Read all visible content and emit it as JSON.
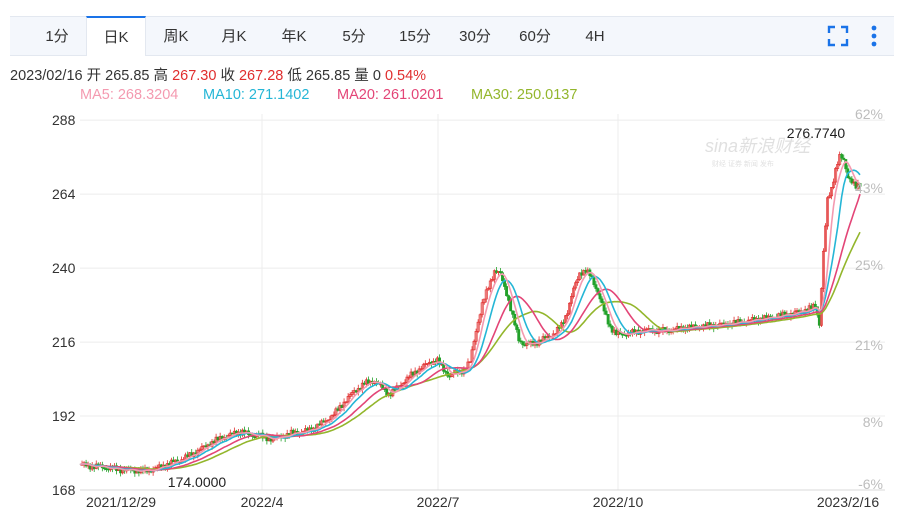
{
  "tabs": [
    {
      "label": "1分"
    },
    {
      "label": "日K",
      "active": true
    },
    {
      "label": "周K"
    },
    {
      "label": "月K"
    },
    {
      "label": "年K"
    },
    {
      "label": "5分"
    },
    {
      "label": "15分"
    },
    {
      "label": "30分"
    },
    {
      "label": "60分"
    },
    {
      "label": "4H"
    }
  ],
  "controls": {
    "fullscreen_icon": "fullscreen-icon",
    "more_icon": "more-vertical-icon"
  },
  "info": {
    "date": "2023/02/16",
    "open_label": "开",
    "open": "265.85",
    "high_label": "高",
    "high": "267.30",
    "close_label": "收",
    "close": "267.28",
    "low_label": "低",
    "low": "265.85",
    "volume_label": "量",
    "volume": "0",
    "change": "0.54%"
  },
  "ma": [
    {
      "label": "MA5: 268.3204",
      "color": "#f49ab0"
    },
    {
      "label": "MA10: 271.1402",
      "color": "#25b6d6"
    },
    {
      "label": "MA20: 261.0201",
      "color": "#e34577"
    },
    {
      "label": "MA30: 250.0137",
      "color": "#93b62c"
    }
  ],
  "colors": {
    "up": "#e02e2e",
    "down": "#23a12a",
    "text_red": "#e02e2e"
  },
  "chart_data": {
    "type": "candlestick",
    "y_ticks": [
      "288",
      "264",
      "240",
      "216",
      "192",
      "168"
    ],
    "right_ticks": [
      "62%",
      "43%",
      "25%",
      "21%",
      "8%",
      "-6%"
    ],
    "x_ticks": [
      "2021/12/29",
      "2022/4",
      "2022/7",
      "2022/10",
      "2023/2/16"
    ],
    "ylim": [
      168,
      290
    ],
    "annotations": {
      "max": "276.7740",
      "min": "174.0000"
    },
    "watermark": {
      "logo": "sina新浪财经",
      "sub": "财经  证券  新闻  发布"
    },
    "close_path": [
      [
        0,
        176.2
      ],
      [
        10,
        175.8
      ],
      [
        20,
        175.5
      ],
      [
        30,
        175.0
      ],
      [
        40,
        174.6
      ],
      [
        50,
        174.4
      ],
      [
        60,
        174.2
      ],
      [
        70,
        174.5
      ],
      [
        80,
        175.6
      ],
      [
        90,
        176.8
      ],
      [
        100,
        178.0
      ],
      [
        110,
        179.5
      ],
      [
        120,
        181.5
      ],
      [
        130,
        183.5
      ],
      [
        140,
        185.0
      ],
      [
        150,
        186.2
      ],
      [
        160,
        187.0
      ],
      [
        168,
        185.5
      ],
      [
        175,
        186.2
      ],
      [
        180,
        185.0
      ],
      [
        190,
        184.6
      ],
      [
        200,
        185.5
      ],
      [
        210,
        186.5
      ],
      [
        220,
        187.0
      ],
      [
        230,
        188.0
      ],
      [
        240,
        190.0
      ],
      [
        250,
        192.5
      ],
      [
        260,
        196.5
      ],
      [
        270,
        200.0
      ],
      [
        280,
        202.5
      ],
      [
        290,
        203.5
      ],
      [
        298,
        201.0
      ],
      [
        305,
        199.0
      ],
      [
        315,
        202.0
      ],
      [
        325,
        205.0
      ],
      [
        335,
        207.5
      ],
      [
        345,
        209.5
      ],
      [
        352,
        210.0
      ],
      [
        358,
        207.0
      ],
      [
        364,
        205.0
      ],
      [
        370,
        206.0
      ],
      [
        378,
        207.0
      ],
      [
        384,
        209.5
      ],
      [
        390,
        220.0
      ],
      [
        396,
        228.0
      ],
      [
        402,
        234.0
      ],
      [
        408,
        239.0
      ],
      [
        414,
        238.0
      ],
      [
        420,
        232.0
      ],
      [
        426,
        224.0
      ],
      [
        432,
        217.0
      ],
      [
        438,
        215.0
      ],
      [
        446,
        215.6
      ],
      [
        454,
        216.5
      ],
      [
        462,
        218.0
      ],
      [
        468,
        219.0
      ],
      [
        474,
        221.5
      ],
      [
        480,
        226.0
      ],
      [
        486,
        233.0
      ],
      [
        492,
        238.5
      ],
      [
        498,
        239.0
      ],
      [
        504,
        237.0
      ],
      [
        510,
        232.0
      ],
      [
        516,
        226.0
      ],
      [
        522,
        221.0
      ],
      [
        528,
        218.5
      ],
      [
        536,
        218.6
      ],
      [
        544,
        219.0
      ],
      [
        552,
        219.6
      ],
      [
        560,
        220.0
      ],
      [
        570,
        219.6
      ],
      [
        580,
        219.8
      ],
      [
        590,
        220.4
      ],
      [
        600,
        220.8
      ],
      [
        610,
        221.0
      ],
      [
        620,
        221.3
      ],
      [
        630,
        221.6
      ],
      [
        640,
        222.0
      ],
      [
        650,
        222.5
      ],
      [
        660,
        223.0
      ],
      [
        670,
        223.6
      ],
      [
        680,
        224.0
      ],
      [
        690,
        224.6
      ],
      [
        700,
        225.2
      ],
      [
        710,
        226.0
      ],
      [
        720,
        227.0
      ],
      [
        724,
        228.0
      ],
      [
        728,
        222.0
      ],
      [
        732,
        245.0
      ],
      [
        736,
        262.0
      ],
      [
        740,
        266.0
      ],
      [
        744,
        272.0
      ],
      [
        748,
        276.0
      ],
      [
        752,
        275.0
      ],
      [
        756,
        270.0
      ],
      [
        760,
        268.0
      ],
      [
        764,
        266.0
      ],
      [
        768,
        267.3
      ]
    ]
  }
}
